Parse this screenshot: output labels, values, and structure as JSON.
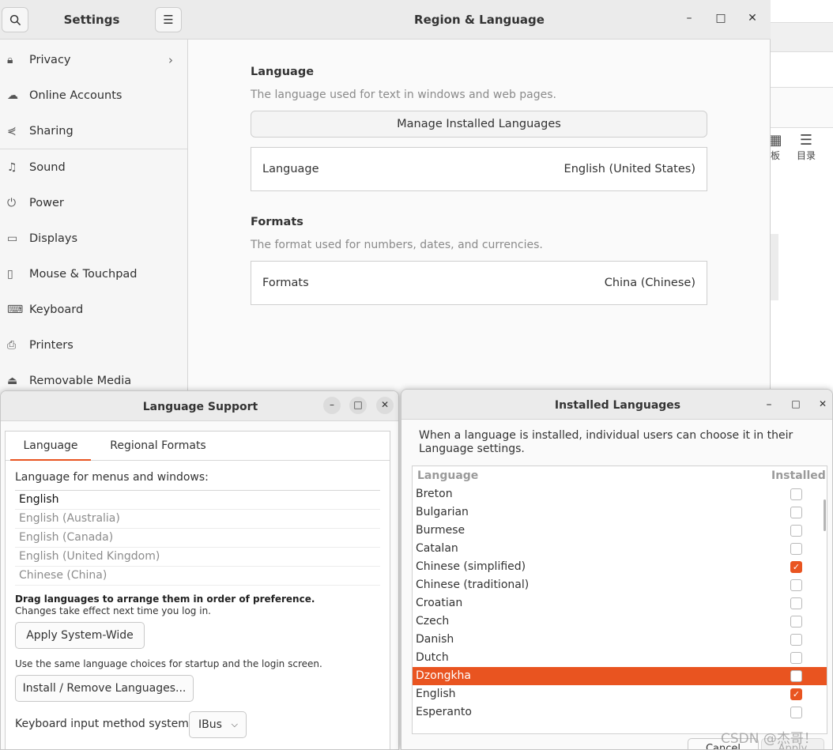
{
  "background_app": {
    "tool1_label": "板",
    "tool2_label": "目录"
  },
  "settings": {
    "sidebar_title": "Settings",
    "search_icon": "search-icon",
    "menu_icon": "hamburger-icon",
    "items": [
      {
        "label": "Privacy",
        "icon": "lock-icon",
        "chevron": "›"
      },
      {
        "label": "Online Accounts",
        "icon": "cloud-icon"
      },
      {
        "label": "Sharing",
        "icon": "share-icon"
      },
      {
        "label": "Sound",
        "icon": "music-note-icon"
      },
      {
        "label": "Power",
        "icon": "power-icon"
      },
      {
        "label": "Displays",
        "icon": "display-icon"
      },
      {
        "label": "Mouse & Touchpad",
        "icon": "mouse-icon"
      },
      {
        "label": "Keyboard",
        "icon": "keyboard-icon"
      },
      {
        "label": "Printers",
        "icon": "printer-icon"
      },
      {
        "label": "Removable Media",
        "icon": "usb-icon"
      }
    ],
    "window_title": "Region & Language",
    "language_section": {
      "title": "Language",
      "description": "The language used for text in windows and web pages.",
      "manage_button": "Manage Installed Languages",
      "row_label": "Language",
      "row_value": "English (United States)"
    },
    "formats_section": {
      "title": "Formats",
      "description": "The format used for numbers, dates, and currencies.",
      "row_label": "Formats",
      "row_value": "China (Chinese)"
    }
  },
  "language_support": {
    "title": "Language Support",
    "tabs": [
      "Language",
      "Regional Formats"
    ],
    "menus_label": "Language for menus and windows:",
    "languages": [
      "English",
      "English (Australia)",
      "English (Canada)",
      "English (United Kingdom)",
      "Chinese (China)"
    ],
    "drag_hint": "Drag languages to arrange them in order of preference.",
    "changes_hint": "Changes take effect next time you log in.",
    "apply_button": "Apply System-Wide",
    "apply_hint": "Use the same language choices for startup and the login screen.",
    "install_button": "Install / Remove Languages...",
    "input_method_label": "Keyboard input method system:",
    "input_method_value": "IBus"
  },
  "installed_languages": {
    "title": "Installed Languages",
    "description": "When a language is installed, individual users can choose it in their Language settings.",
    "col_language": "Language",
    "col_installed": "Installed",
    "rows": [
      {
        "name": "Breton",
        "installed": false
      },
      {
        "name": "Bulgarian",
        "installed": false
      },
      {
        "name": "Burmese",
        "installed": false
      },
      {
        "name": "Catalan",
        "installed": false
      },
      {
        "name": "Chinese (simplified)",
        "installed": true
      },
      {
        "name": "Chinese (traditional)",
        "installed": false
      },
      {
        "name": "Croatian",
        "installed": false
      },
      {
        "name": "Czech",
        "installed": false
      },
      {
        "name": "Danish",
        "installed": false
      },
      {
        "name": "Dutch",
        "installed": false
      },
      {
        "name": "Dzongkha",
        "installed": false,
        "selected": true
      },
      {
        "name": "English",
        "installed": true
      },
      {
        "name": "Esperanto",
        "installed": false
      }
    ],
    "cancel_button": "Cancel",
    "apply_button": "Apply"
  },
  "watermark": "CSDN @杰哥！",
  "colors": {
    "accent": "#e95420"
  }
}
